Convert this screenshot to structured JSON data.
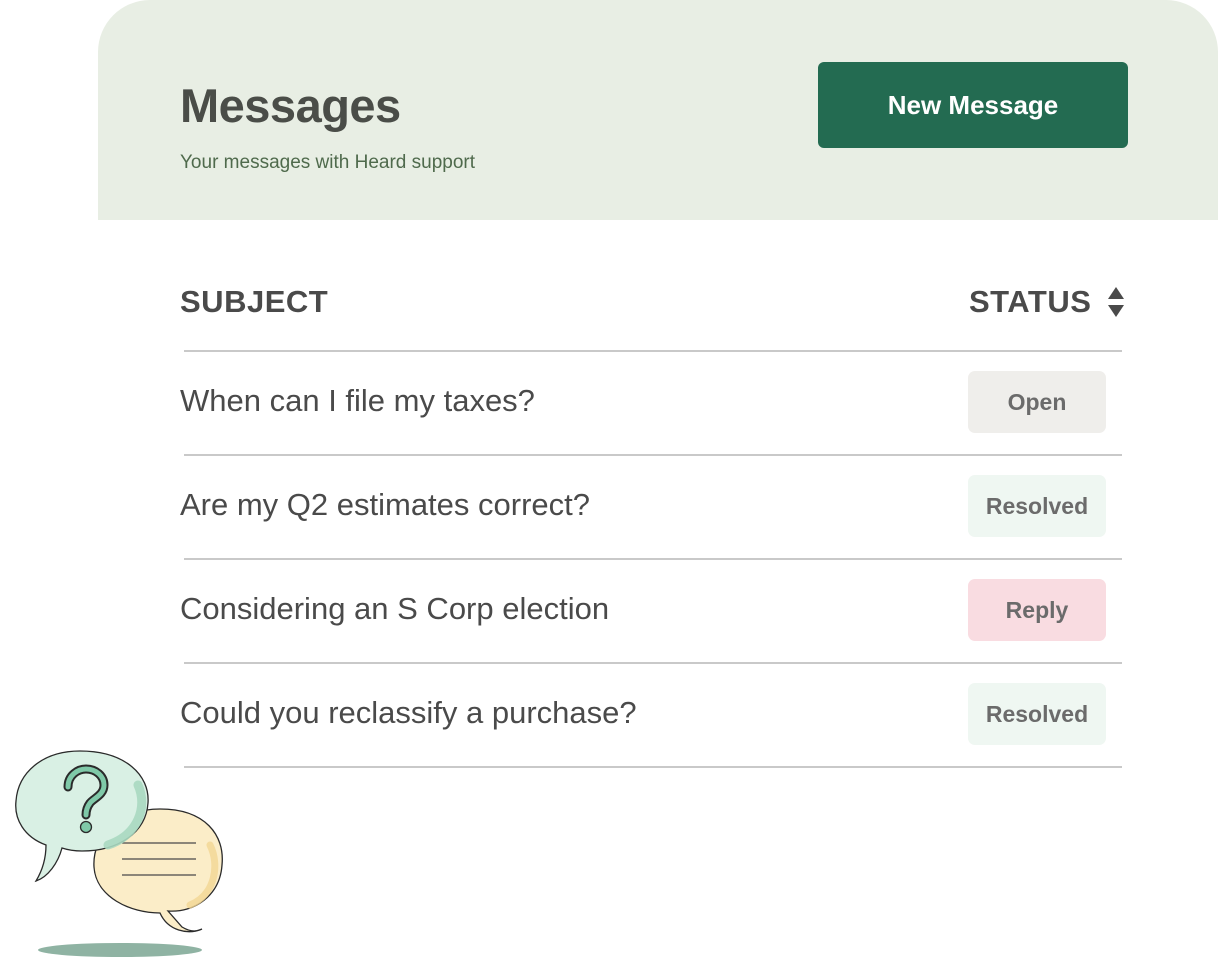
{
  "header": {
    "title": "Messages",
    "subtitle": "Your messages with Heard support",
    "new_message_label": "New Message"
  },
  "table": {
    "columns": {
      "subject": "SUBJECT",
      "status": "STATUS"
    },
    "sort_icon": "sort-up-down-icon",
    "rows": [
      {
        "subject": "When can I file my taxes?",
        "status": "Open"
      },
      {
        "subject": "Are my Q2 estimates correct?",
        "status": "Resolved"
      },
      {
        "subject": "Considering an S Corp election",
        "status": "Reply"
      },
      {
        "subject": "Could you reclassify a purchase?",
        "status": "Resolved"
      }
    ]
  },
  "illustration": {
    "icon": "chat-bubbles-question-icon"
  },
  "colors": {
    "header_bg": "#e8eee4",
    "primary_button": "#236b51",
    "status_open_bg": "#efeeeb",
    "status_resolved_bg": "#eff7f2",
    "status_reply_bg": "#f9dce1"
  }
}
